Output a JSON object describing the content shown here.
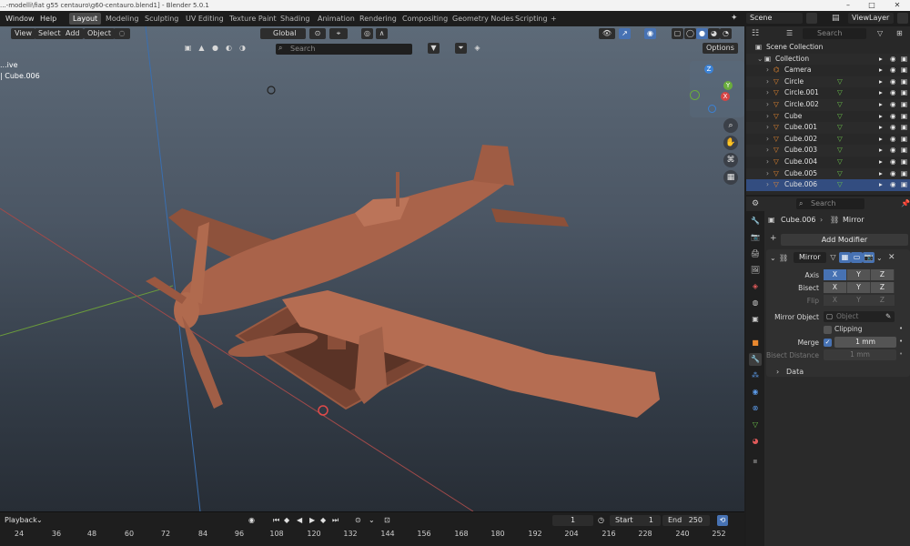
{
  "window": {
    "title": "...-modelli\\fiat g55 centauro\\g60-centauro.blend1] - Blender 5.0.1",
    "minimize": "–",
    "maximize": "□",
    "close": "✕"
  },
  "menu": {
    "window": "Window",
    "help": "Help"
  },
  "workspaces": [
    "Layout",
    "Modeling",
    "Sculpting",
    "UV Editing",
    "Texture Paint",
    "Shading",
    "Animation",
    "Rendering",
    "Compositing",
    "Geometry Nodes",
    "Scripting"
  ],
  "active_workspace": "Layout",
  "add_workspace": "+",
  "scene": {
    "label": "Scene",
    "view_layer": "ViewLayer"
  },
  "viewport": {
    "menus": {
      "view": "View",
      "select": "Select",
      "add": "Add",
      "object": "Object"
    },
    "transform_orientation": "Global",
    "search_placeholder": "Search",
    "options": "Options",
    "overlay_text": {
      "line1": "...ive",
      "line2": "| Cube.006"
    },
    "gizmo_axes": {
      "x": "X",
      "y": "Y",
      "z": "Z"
    }
  },
  "timeline": {
    "playback": "Playback",
    "current_frame": "1",
    "start_label": "Start",
    "start": "1",
    "end_label": "End",
    "end": "250",
    "ticks": [
      "24",
      "36",
      "48",
      "60",
      "72",
      "84",
      "96",
      "108",
      "120",
      "132",
      "144",
      "156",
      "168",
      "180",
      "192",
      "204",
      "216",
      "228",
      "240",
      "252"
    ]
  },
  "outliner": {
    "search_placeholder": "Search",
    "items": [
      {
        "label": "Scene Collection",
        "indent": 0,
        "icon": "collection-icon"
      },
      {
        "label": "Collection",
        "indent": 1,
        "icon": "collection-icon"
      },
      {
        "label": "Camera",
        "indent": 2,
        "icon": "camera-icon"
      },
      {
        "label": "Circle",
        "indent": 2,
        "icon": "mesh-icon"
      },
      {
        "label": "Circle.001",
        "indent": 2,
        "icon": "mesh-icon"
      },
      {
        "label": "Circle.002",
        "indent": 2,
        "icon": "mesh-icon"
      },
      {
        "label": "Cube",
        "indent": 2,
        "icon": "mesh-icon"
      },
      {
        "label": "Cube.001",
        "indent": 2,
        "icon": "mesh-icon"
      },
      {
        "label": "Cube.002",
        "indent": 2,
        "icon": "mesh-icon"
      },
      {
        "label": "Cube.003",
        "indent": 2,
        "icon": "mesh-icon"
      },
      {
        "label": "Cube.004",
        "indent": 2,
        "icon": "mesh-icon"
      },
      {
        "label": "Cube.005",
        "indent": 2,
        "icon": "mesh-icon"
      },
      {
        "label": "Cube.006",
        "indent": 2,
        "icon": "mesh-icon",
        "selected": true
      }
    ]
  },
  "properties": {
    "search_placeholder": "Search",
    "breadcrumb": {
      "object": "Cube.006",
      "modifier": "Mirror"
    },
    "add_modifier": "Add Modifier",
    "modifier": {
      "name": "Mirror",
      "axis_label": "Axis",
      "bisect_label": "Bisect",
      "flip_label": "Flip",
      "axes": [
        "X",
        "Y",
        "Z"
      ],
      "axis_state": [
        true,
        false,
        false
      ],
      "mirror_object_label": "Mirror Object",
      "mirror_object_placeholder": "Object",
      "clipping_label": "Clipping",
      "merge_label": "Merge",
      "merge_value": "1 mm",
      "bisect_distance_label": "Bisect Distance",
      "bisect_distance_value": "1 mm",
      "data_label": "Data"
    }
  },
  "colors": {
    "accent": "#4772b3",
    "model": "#b06a4e",
    "selection": "#334d80"
  }
}
